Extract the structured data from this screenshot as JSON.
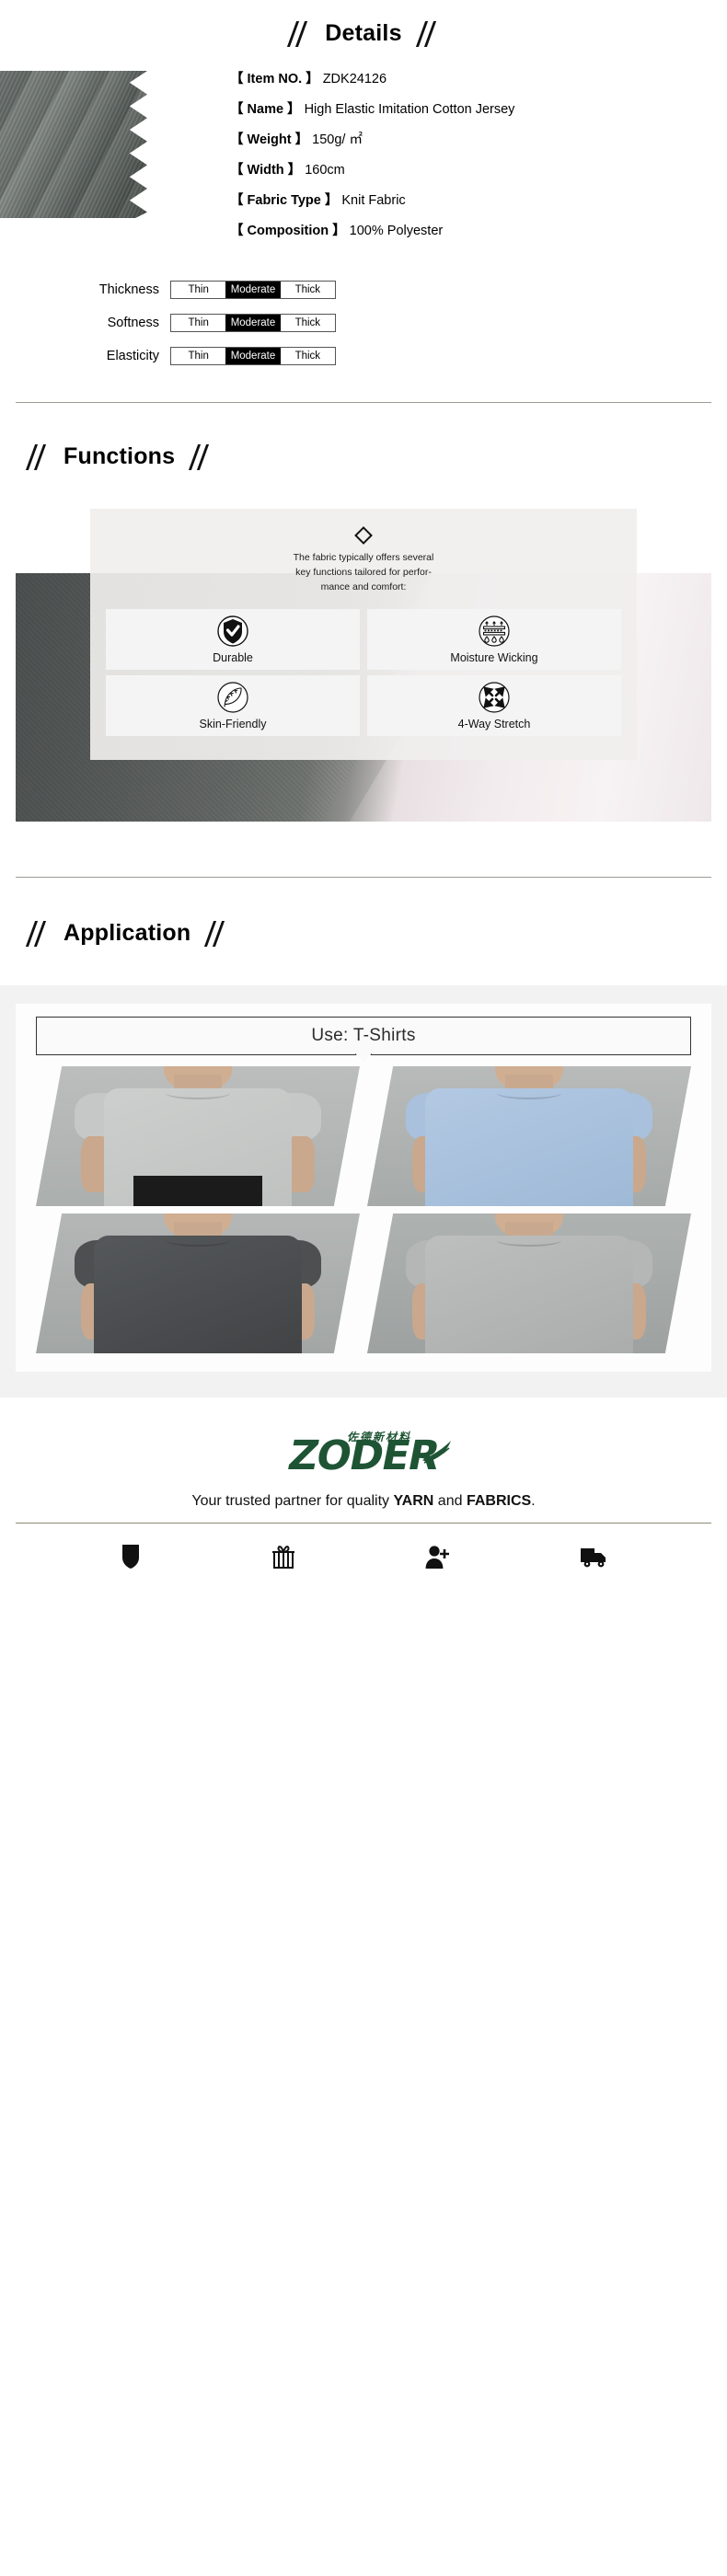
{
  "details": {
    "heading": "Details",
    "specs": [
      {
        "key": "【 Item NO. 】",
        "value": "ZDK24126"
      },
      {
        "key": "【 Name 】",
        "value": "High Elastic Imitation Cotton Jersey"
      },
      {
        "key": "【 Weight 】",
        "value": "150g/ ㎡"
      },
      {
        "key": "【 Width 】",
        "value": "160cm"
      },
      {
        "key": "【 Fabric Type 】",
        "value": "Knit Fabric"
      },
      {
        "key": "【 Composition 】",
        "value": "100% Polyester"
      }
    ],
    "ratings": [
      {
        "label": "Thickness",
        "options": [
          "Thin",
          "Moderate",
          "Thick"
        ],
        "selected": "Moderate"
      },
      {
        "label": "Softness",
        "options": [
          "Thin",
          "Moderate",
          "Thick"
        ],
        "selected": "Moderate"
      },
      {
        "label": "Elasticity",
        "options": [
          "Thin",
          "Moderate",
          "Thick"
        ],
        "selected": "Moderate"
      }
    ]
  },
  "functions": {
    "heading": "Functions",
    "intro_line1": "The fabric typically offers several",
    "intro_line2": "key functions tailored for perfor-",
    "intro_line3": "mance and comfort:",
    "cards": [
      {
        "label": "Durable",
        "icon": "shield-check-icon"
      },
      {
        "label": "Moisture Wicking",
        "icon": "moisture-wicking-icon"
      },
      {
        "label": "Skin-Friendly",
        "icon": "feather-icon"
      },
      {
        "label": "4-Way Stretch",
        "icon": "four-way-arrows-icon"
      }
    ]
  },
  "application": {
    "heading": "Application",
    "use_banner": "Use: T-Shirts",
    "shirts": [
      {
        "name": "heather-grey-womens-tee",
        "shirt_color": "#c6c8c7",
        "bg": "#b5b8b7",
        "shorts": true,
        "female": true
      },
      {
        "name": "light-blue-mens-tee",
        "shirt_color": "#a9c1dd",
        "bg": "#b3b6b5",
        "shorts": false,
        "female": false
      },
      {
        "name": "charcoal-mens-tee",
        "shirt_color": "#4d4f50",
        "bg": "#b0b3b2",
        "shorts": false,
        "female": false
      },
      {
        "name": "light-grey-mens-tee",
        "shirt_color": "#b4b7b6",
        "bg": "#a8abaa",
        "shorts": false,
        "female": false
      }
    ]
  },
  "footer": {
    "logo_cn": "佐德新材料",
    "logo_text": "ZODER",
    "logo_color": "#1e5434",
    "tagline_pre": "Your trusted partner for quality ",
    "tagline_b1": "YARN",
    "tagline_mid": " and ",
    "tagline_b2": "FABRICS",
    "tagline_end": ".",
    "icons": [
      {
        "name": "shield-icon"
      },
      {
        "name": "gift-icon"
      },
      {
        "name": "add-user-icon"
      },
      {
        "name": "delivery-truck-icon"
      }
    ]
  }
}
